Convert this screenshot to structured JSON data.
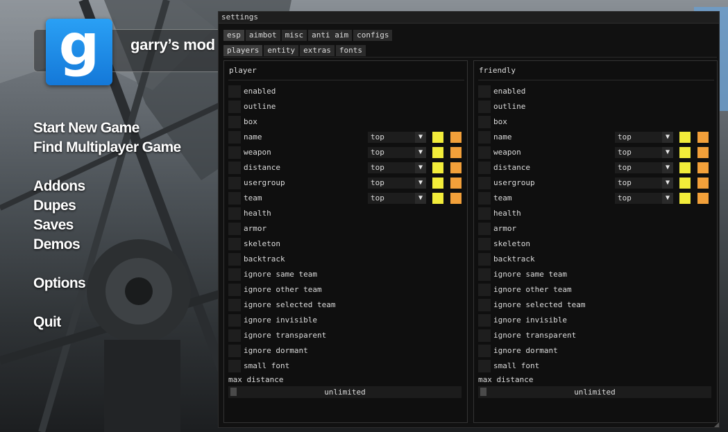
{
  "logo": {
    "glyph": "g",
    "text": "garry’s mod"
  },
  "menu": [
    {
      "label": "Start New Game"
    },
    {
      "label": "Find Multiplayer Game"
    },
    {
      "label": "Addons"
    },
    {
      "label": "Dupes"
    },
    {
      "label": "Saves"
    },
    {
      "label": "Demos"
    },
    {
      "label": "Options"
    },
    {
      "label": "Quit"
    }
  ],
  "window": {
    "title": "settings",
    "tabs": [
      "esp",
      "aimbot",
      "misc",
      "anti aim",
      "configs"
    ],
    "active_tab": "esp",
    "subtabs": [
      "players",
      "entity",
      "extras",
      "fonts"
    ],
    "active_subtab": "players",
    "panels": [
      {
        "title": "player",
        "options": [
          {
            "label": "enabled"
          },
          {
            "label": "outline"
          },
          {
            "label": "box"
          },
          {
            "label": "name",
            "position": "top"
          },
          {
            "label": "weapon",
            "position": "top"
          },
          {
            "label": "distance",
            "position": "top"
          },
          {
            "label": "usergroup",
            "position": "top"
          },
          {
            "label": "team",
            "position": "top"
          },
          {
            "label": "health"
          },
          {
            "label": "armor"
          },
          {
            "label": "skeleton"
          },
          {
            "label": "backtrack"
          },
          {
            "label": "ignore same team"
          },
          {
            "label": "ignore other team"
          },
          {
            "label": "ignore selected team"
          },
          {
            "label": "ignore invisible"
          },
          {
            "label": "ignore transparent"
          },
          {
            "label": "ignore dormant"
          },
          {
            "label": "small font"
          }
        ],
        "max_distance_label": "max distance",
        "max_distance_value": "unlimited"
      },
      {
        "title": "friendly",
        "options": [
          {
            "label": "enabled"
          },
          {
            "label": "outline"
          },
          {
            "label": "box"
          },
          {
            "label": "name",
            "position": "top"
          },
          {
            "label": "weapon",
            "position": "top"
          },
          {
            "label": "distance",
            "position": "top"
          },
          {
            "label": "usergroup",
            "position": "top"
          },
          {
            "label": "team",
            "position": "top"
          },
          {
            "label": "health"
          },
          {
            "label": "armor"
          },
          {
            "label": "skeleton"
          },
          {
            "label": "backtrack"
          },
          {
            "label": "ignore same team"
          },
          {
            "label": "ignore other team"
          },
          {
            "label": "ignore selected team"
          },
          {
            "label": "ignore invisible"
          },
          {
            "label": "ignore transparent"
          },
          {
            "label": "ignore dormant"
          },
          {
            "label": "small font"
          }
        ],
        "max_distance_label": "max distance",
        "max_distance_value": "unlimited"
      }
    ],
    "colors": {
      "swatch_primary": "#f2ec3a",
      "swatch_secondary": "#f2a03a",
      "checkbox": "#1e1e1e",
      "window_bg": "#111111"
    },
    "icons": {
      "dropdown": "chevron-down-icon",
      "resize": "resize-grip-icon"
    }
  }
}
